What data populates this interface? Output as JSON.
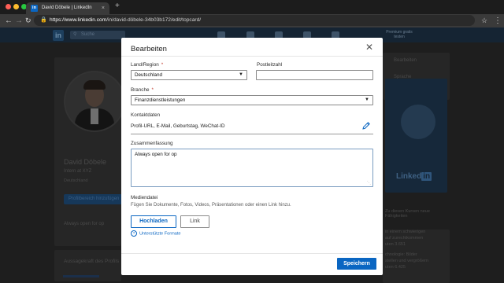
{
  "browser": {
    "tab_title": "David Döbele | LinkedIn",
    "tab_favicon": "in",
    "tab_close": "×",
    "new_tab": "+",
    "url_host": "https://www.linkedin.com",
    "url_path": "/in/david-döbele-34b03b172/edit/topcard/",
    "traffic_lights": [
      "#ff5f57",
      "#febc2e",
      "#28c840"
    ]
  },
  "background": {
    "logo": "in",
    "search_placeholder": "Suche",
    "premium_text": "Premium gratis testen",
    "profile_name": "David Döbele",
    "profile_headline": "Intern at XYZ",
    "profile_location": "Deutschland",
    "profile_button": "Profilbereich hinzufügen",
    "profile_summary": "Always open for op",
    "aussage_title": "Aussagekraft des Profils",
    "side_items": [
      "Bearbeiten",
      "Sprache"
    ],
    "side_logo": "Linked in",
    "side_course": "Zu diesen Kursen neue Fähigkeiten",
    "side_links": [
      "in einem schwierigen",
      "auf zurechtkommen",
      "uten 3.651",
      "chnologie: Bilder",
      "stellen und vergrößern",
      "uten 6.425"
    ]
  },
  "modal": {
    "title": "Bearbeiten",
    "close_icon": "close-icon",
    "country": {
      "label": "Land/Region",
      "required_mark": "*",
      "value": "Deutschland"
    },
    "postal": {
      "label": "Postleitzahl",
      "value": ""
    },
    "industry": {
      "label": "Branche",
      "required_mark": "*",
      "value": "Finanzdienstleistungen"
    },
    "contact": {
      "label": "Kontaktdaten",
      "value": "Profil-URL, E-Mail, Geburtstag, WeChat-ID",
      "edit_icon": "pencil-icon"
    },
    "summary": {
      "label": "Zusammenfassung",
      "value": "Always open for op"
    },
    "media": {
      "label": "Mediendatei",
      "hint": "Fügen Sie Dokumente, Fotos, Videos, Präsentationen oder einen Link hinzu.",
      "upload_label": "Hochladen",
      "link_label": "Link",
      "formats_label": "Unterstützte Formate"
    },
    "save_label": "Speichern",
    "accent": "#0a66c2"
  }
}
